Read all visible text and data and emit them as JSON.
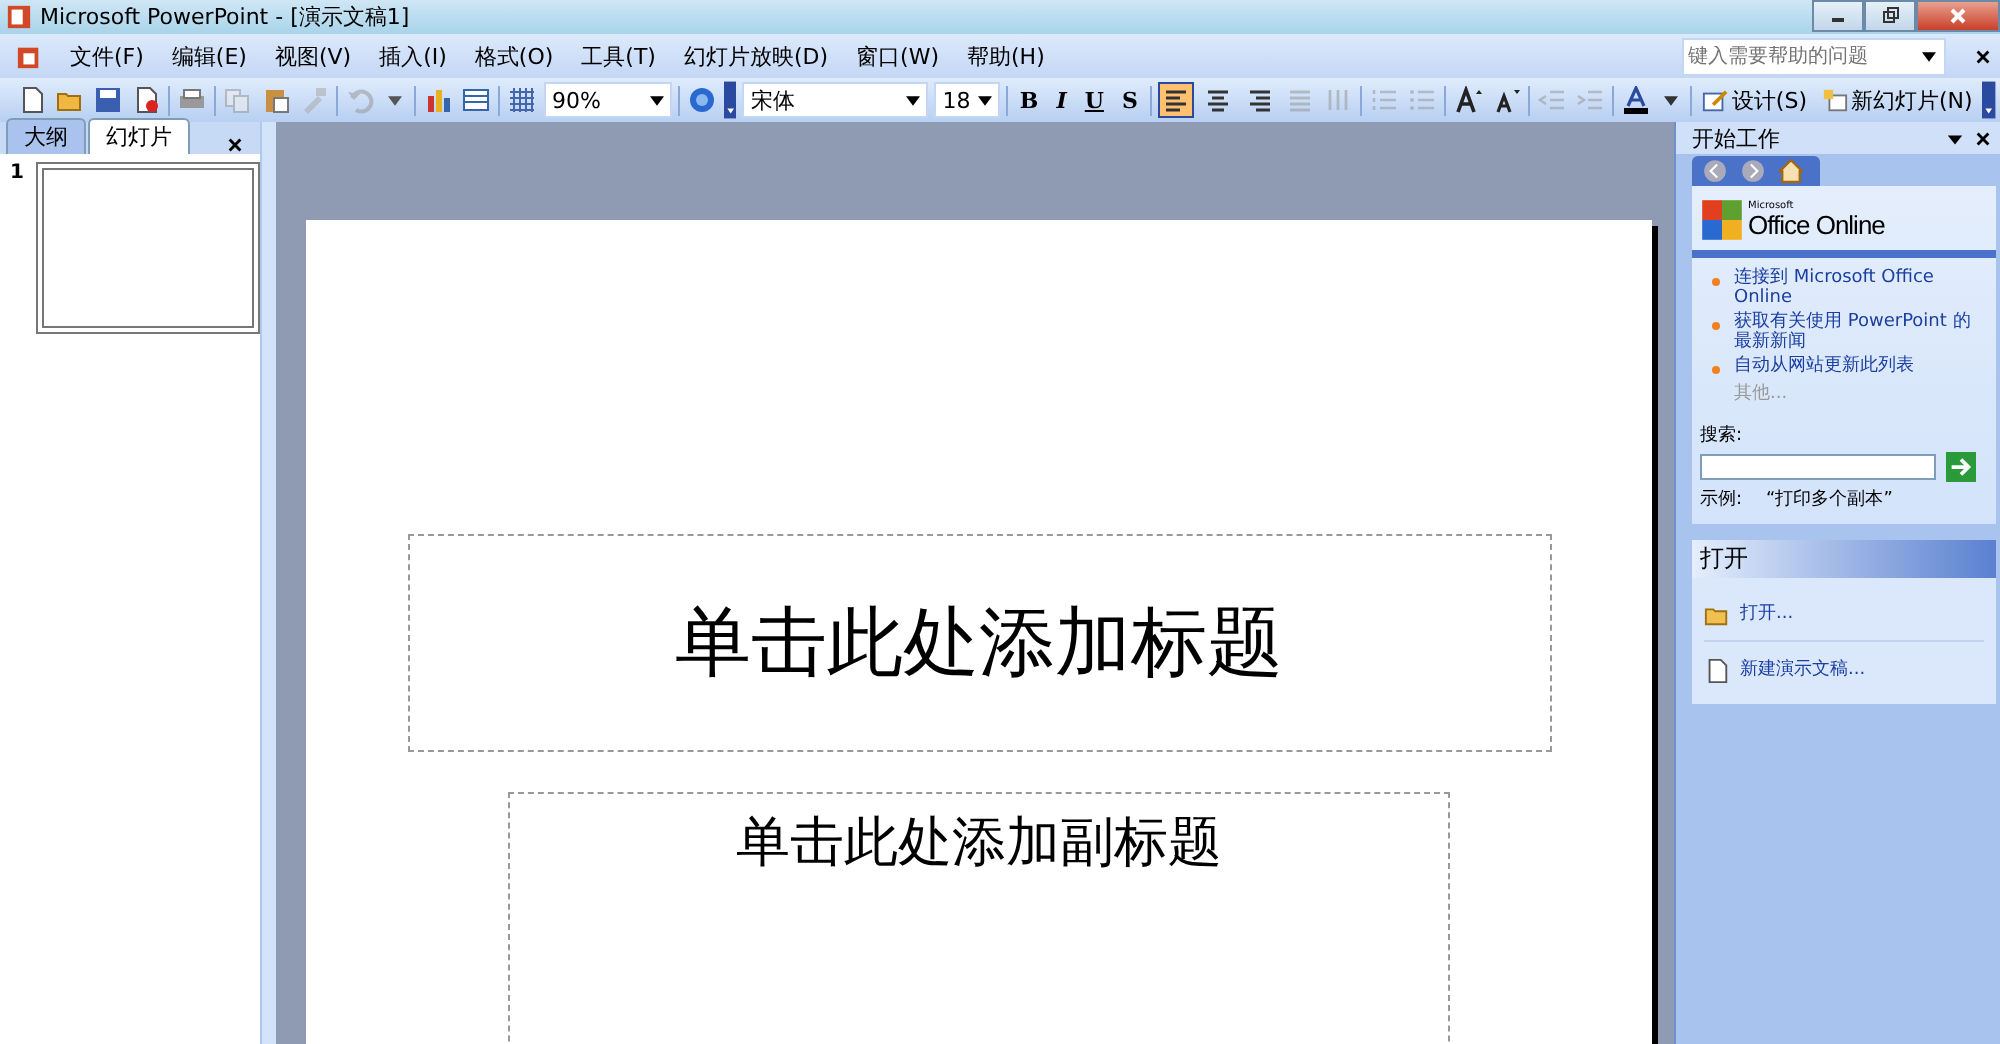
{
  "window": {
    "title": "Microsoft PowerPoint - [演示文稿1]"
  },
  "menu": {
    "items": [
      "文件(F)",
      "编辑(E)",
      "视图(V)",
      "插入(I)",
      "格式(O)",
      "工具(T)",
      "幻灯片放映(D)",
      "窗口(W)",
      "帮助(H)"
    ],
    "help_placeholder": "键入需要帮助的问题"
  },
  "toolbar": {
    "zoom": "90%",
    "font": "宋体",
    "size": "18",
    "format_buttons": [
      "B",
      "I",
      "U",
      "S"
    ],
    "align": [
      {
        "selected": true
      },
      {
        "selected": false
      },
      {
        "selected": false
      }
    ],
    "design": "设计(S)",
    "new_slide": "新幻灯片(N)"
  },
  "left_pane": {
    "tabs": [
      {
        "label": "大纲",
        "selected": false
      },
      {
        "label": "幻灯片",
        "selected": true
      }
    ],
    "slides": [
      {
        "number": "1",
        "selected": true
      }
    ]
  },
  "slide": {
    "title_placeholder": "单击此处添加标题",
    "subtitle_placeholder": "单击此处添加副标题"
  },
  "task_pane": {
    "title": "开始工作",
    "logo_small": "Microsoft",
    "logo": "Office Online",
    "links": [
      "连接到 Microsoft Office Online",
      "获取有关使用 PowerPoint 的最新新闻",
      "自动从网站更新此列表"
    ],
    "more": "其他...",
    "search_label": "搜索:",
    "example_label": "示例:",
    "example": "“打印多个副本”",
    "open_section": "打开",
    "open_items": [
      {
        "kind": "folder",
        "label": "打开..."
      },
      {
        "kind": "document",
        "label": "新建演示文稿..."
      }
    ]
  }
}
